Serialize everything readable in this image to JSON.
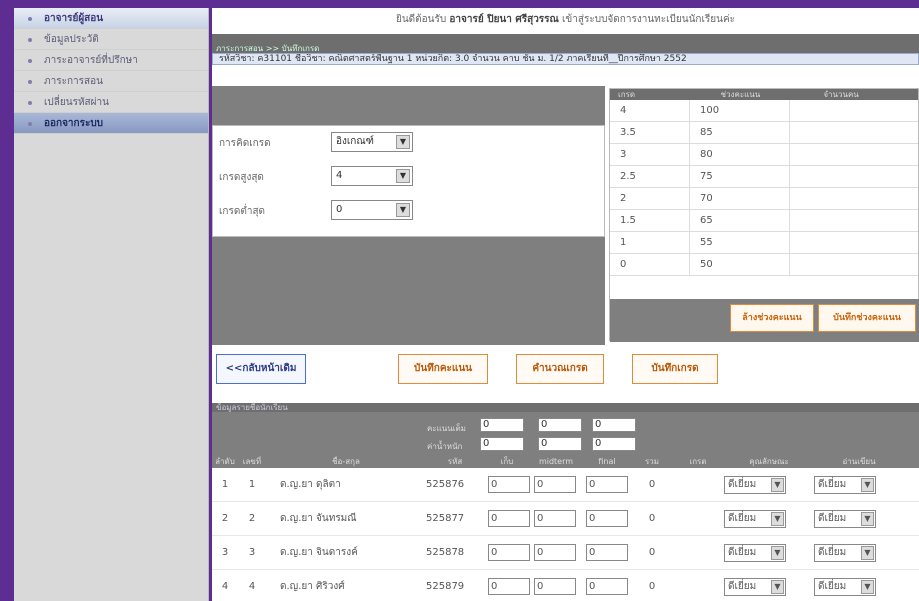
{
  "sidebar": {
    "items": [
      {
        "label": "อาจารย์ผู้สอน",
        "style": "head"
      },
      {
        "label": "ข้อมูลประวัติ",
        "style": "normal"
      },
      {
        "label": "ภาระอาจารย์ที่ปรึกษา",
        "style": "normal"
      },
      {
        "label": "ภาระการสอน",
        "style": "normal"
      },
      {
        "label": "เปลี่ยนรหัสผ่าน",
        "style": "normal"
      },
      {
        "label": "ออกจากระบบ",
        "style": "active"
      }
    ]
  },
  "header": {
    "welcome_prefix": "ยินดีต้อนรับ",
    "teacher_name": "อาจารย์ ปิยนา ศรีสุวรรณ",
    "welcome_suffix": "เข้าสู่ระบบจัดการงานทะเบียนนักเรียนค่ะ",
    "breadcrumb": "ภาระการสอน >> บันทึกเกรด",
    "subject_line": "รหัสวิชา: ค31101  ชื่อวิชา: คณิตศาสตร์พื้นฐาน 1  หน่วยกิต: 3.0  จำนวน คาบ  ชั้น ม. 1/2  ภาคเรียนที่__ปีการศึกษา 2552"
  },
  "grade_form": {
    "type_label": "การคิดเกรด",
    "type_value": "อิงเกณฑ์",
    "max_label": "เกรดสูงสุด",
    "max_value": "4",
    "min_label": "เกรดต่ำสุด",
    "min_value": "0"
  },
  "grade_table": {
    "headers": [
      "เกรด",
      "ช่วงคะแนน",
      "จำนวนคน"
    ],
    "rows": [
      {
        "grade": "4",
        "score": "100",
        "count": ""
      },
      {
        "grade": "3.5",
        "score": "85",
        "count": ""
      },
      {
        "grade": "3",
        "score": "80",
        "count": ""
      },
      {
        "grade": "2.5",
        "score": "75",
        "count": ""
      },
      {
        "grade": "2",
        "score": "70",
        "count": ""
      },
      {
        "grade": "1.5",
        "score": "65",
        "count": ""
      },
      {
        "grade": "1",
        "score": "55",
        "count": ""
      },
      {
        "grade": "0",
        "score": "50",
        "count": ""
      }
    ],
    "reset_label": "ล้างช่วงคะแนน",
    "save_label": "บันทึกช่วงคะแนน"
  },
  "actions": {
    "back": "<<กลับหน้าเดิม",
    "save_score": "บันทึกคะแนน",
    "calc_grade": "คำนวณเกรด",
    "save_grade": "บันทึกเกรด"
  },
  "students": {
    "section_title": "ข้อมูลรายชื่อนักเรียน",
    "full_label": "คะแนนเต็ม",
    "weight_label": "ค่าน้ำหนัก",
    "full_values": [
      "0",
      "0",
      "0"
    ],
    "weight_values": [
      "0",
      "0",
      "0"
    ],
    "columns": [
      "ลำดับ",
      "เลขที่",
      "ชื่อ-สกุล",
      "รหัส",
      "เก็บ",
      "midterm",
      "final",
      "รวม",
      "เกรด",
      "คุณลักษณะ",
      "อ่านเขียน"
    ],
    "rows": [
      {
        "no": "1",
        "num": "1",
        "name": "ด.ญ.ยา  ดุลิตา",
        "id": "525876",
        "keep": "0",
        "mid": "0",
        "final": "0",
        "total": "0",
        "trait": "ดีเยี่ยม",
        "read": "ดีเยี่ยม"
      },
      {
        "no": "2",
        "num": "2",
        "name": "ด.ญ.ยา  จันทรมณี",
        "id": "525877",
        "keep": "0",
        "mid": "0",
        "final": "0",
        "total": "0",
        "trait": "ดีเยี่ยม",
        "read": "ดีเยี่ยม"
      },
      {
        "no": "3",
        "num": "3",
        "name": "ด.ญ.ยา  จินดารงค์",
        "id": "525878",
        "keep": "0",
        "mid": "0",
        "final": "0",
        "total": "0",
        "trait": "ดีเยี่ยม",
        "read": "ดีเยี่ยม"
      },
      {
        "no": "4",
        "num": "4",
        "name": "ด.ญ.ยา  ศิริวงศ์",
        "id": "525879",
        "keep": "0",
        "mid": "0",
        "final": "0",
        "total": "0",
        "trait": "ดีเยี่ยม",
        "read": "ดีเยี่ยม"
      }
    ]
  },
  "colors": {
    "frame": "#5e2d91",
    "accent": "#e08a3a",
    "panel": "#7f7f7f"
  }
}
